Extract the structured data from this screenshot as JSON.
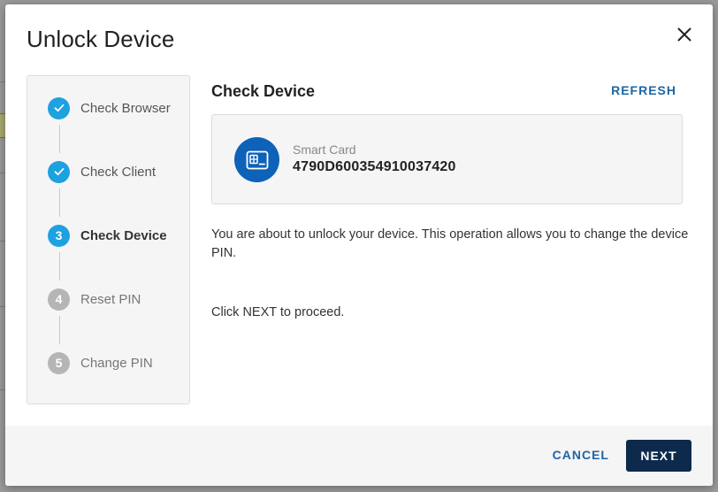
{
  "dialog": {
    "title": "Unlock Device",
    "close_icon": "close-icon"
  },
  "stepper": {
    "steps": [
      {
        "number": "1",
        "label": "Check Browser",
        "state": "done",
        "icon": "check-icon"
      },
      {
        "number": "2",
        "label": "Check Client",
        "state": "done",
        "icon": "check-icon"
      },
      {
        "number": "3",
        "label": "Check Device",
        "state": "active"
      },
      {
        "number": "4",
        "label": "Reset PIN",
        "state": "pending"
      },
      {
        "number": "5",
        "label": "Change PIN",
        "state": "pending"
      }
    ]
  },
  "main": {
    "section_title": "Check Device",
    "refresh_label": "REFRESH",
    "device": {
      "type": "Smart Card",
      "id": "4790D600354910037420",
      "icon": "smart-card-icon"
    },
    "description": "You are about to unlock your device. This operation allows you to change the device PIN.",
    "proceed_text": "Click NEXT to proceed."
  },
  "footer": {
    "cancel_label": "CANCEL",
    "next_label": "NEXT"
  },
  "colors": {
    "accent": "#1da1e0",
    "primary_button": "#0d2a4d",
    "link": "#1d65a6",
    "device_avatar": "#0e62b8",
    "pending_step": "#b5b5b5"
  }
}
